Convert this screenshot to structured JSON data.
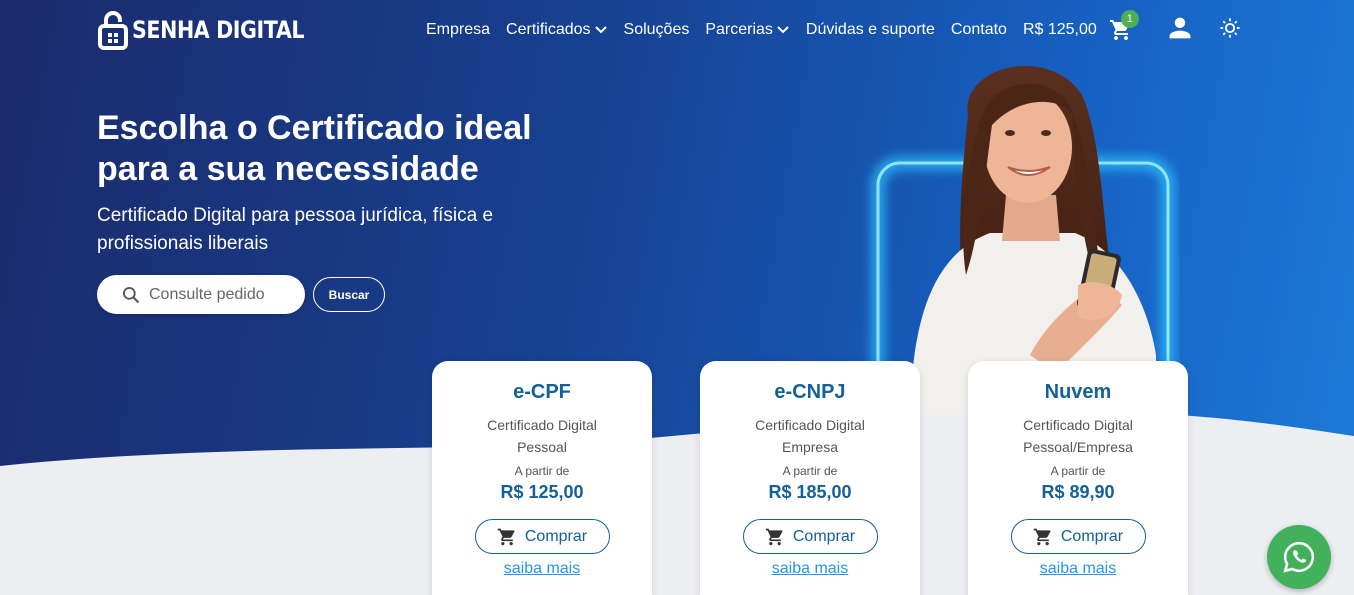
{
  "brand": {
    "name": "SENHA DIGITAL"
  },
  "nav": {
    "items": [
      {
        "label": "Empresa",
        "dropdown": false
      },
      {
        "label": "Certificados",
        "dropdown": true
      },
      {
        "label": "Soluções",
        "dropdown": false
      },
      {
        "label": "Parcerias",
        "dropdown": true
      },
      {
        "label": "Dúvidas e suporte",
        "dropdown": false
      },
      {
        "label": "Contato",
        "dropdown": false
      }
    ],
    "cart_total": "R$ 125,00",
    "cart_count": "1",
    "icons": [
      "cart-icon",
      "user-icon",
      "theme-toggle-icon"
    ]
  },
  "hero": {
    "headline": "Escolha o Certificado ideal para a sua necessidade",
    "subline": "Certificado Digital para pessoa jurídica, física e profissionais liberais",
    "search_placeholder": "Consulte pedido",
    "search_button": "Buscar"
  },
  "cards": [
    {
      "title": "e-CPF",
      "desc": "Certificado Digital Pessoal",
      "from": "A partir de",
      "price": "R$ 125,00",
      "buy": "Comprar",
      "more": "saiba mais"
    },
    {
      "title": "e-CNPJ",
      "desc": "Certificado Digital Empresa",
      "from": "A partir de",
      "price": "R$ 185,00",
      "buy": "Comprar",
      "more": "saiba mais"
    },
    {
      "title": "Nuvem",
      "desc": "Certificado Digital Pessoal/Empresa",
      "from": "A partir de",
      "price": "R$ 89,90",
      "buy": "Comprar",
      "more": "saiba mais"
    }
  ],
  "colors": {
    "hero_start": "#1b2a6b",
    "hero_end": "#1d7ad8",
    "accent": "#14609a",
    "link": "#2196f3",
    "badge": "#4caf50",
    "whatsapp": "#43b05c",
    "neon": "#2ec5ff"
  }
}
